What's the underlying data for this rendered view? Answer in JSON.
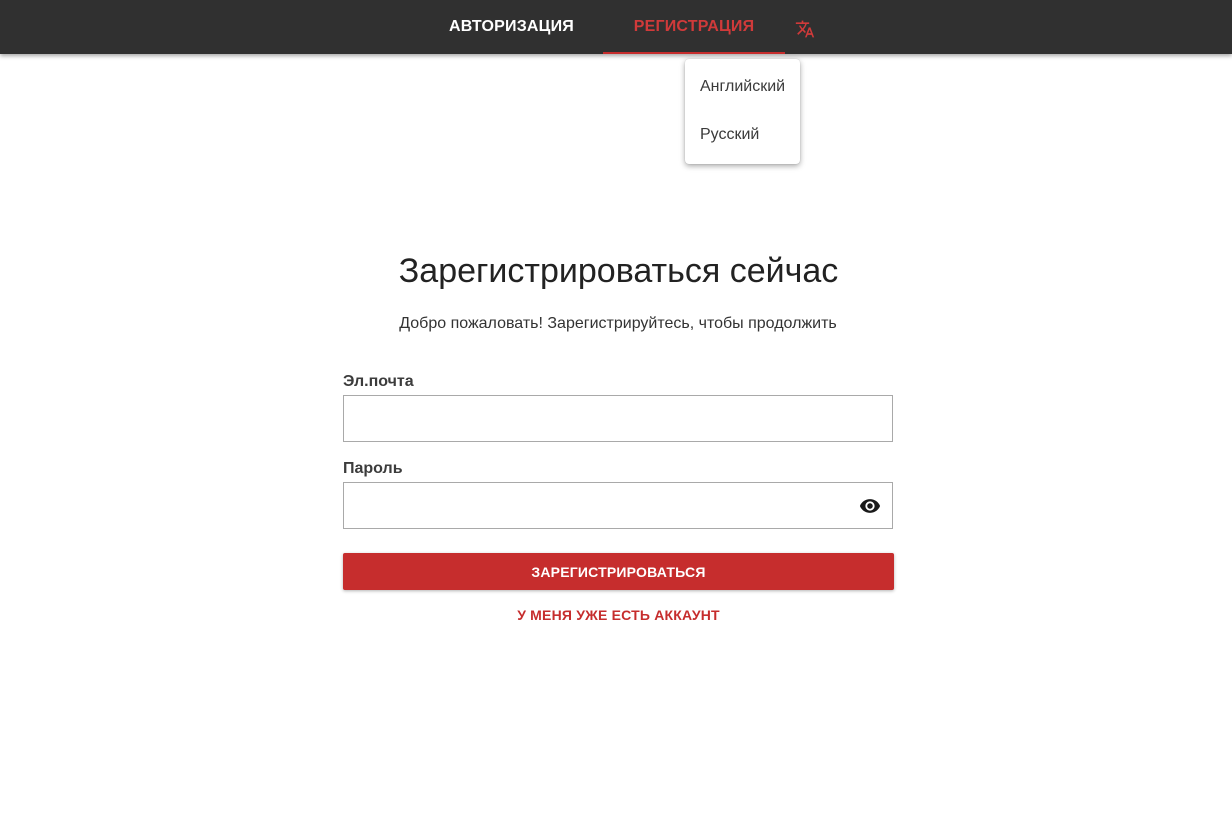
{
  "nav": {
    "tabs": [
      {
        "label": "АВТОРИЗАЦИЯ",
        "active": false
      },
      {
        "label": "РЕГИСТРАЦИЯ",
        "active": true
      }
    ],
    "language_icon": "translate-icon"
  },
  "language_menu": {
    "items": [
      {
        "label": "Английский"
      },
      {
        "label": "Русский"
      }
    ]
  },
  "form": {
    "title": "Зарегистрироваться сейчас",
    "subtitle": "Добро пожаловать! Зарегистрируйтесь, чтобы продолжить",
    "email_label": "Эл.почта",
    "email_value": "",
    "password_label": "Пароль",
    "password_value": "",
    "password_toggle_icon": "eye-icon",
    "submit_label": "ЗАРЕГИСТРИРОВАТЬСЯ",
    "have_account_label": "У МЕНЯ УЖЕ ЕСТЬ АККАУНТ"
  },
  "colors": {
    "accent": "#c62d2d",
    "topbar": "#303030"
  }
}
